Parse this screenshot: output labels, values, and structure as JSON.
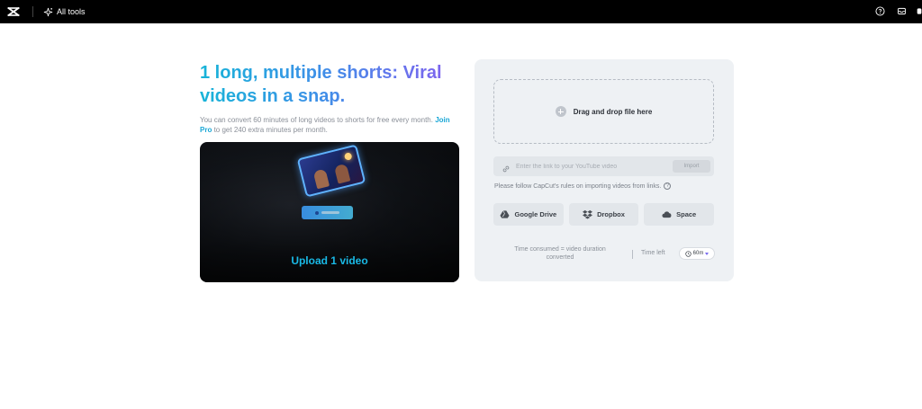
{
  "topbar": {
    "logo_icon": "capcut-logo-icon",
    "all_tools_label": "All tools",
    "right_icons": [
      "help-circle-icon",
      "inbox-icon",
      "profile-icon"
    ]
  },
  "hero": {
    "headline": "1 long, multiple shorts: Viral videos in a snap.",
    "subtext_prefix": "You can convert 60 minutes of long videos to shorts for free every month.",
    "join_pro_label": "Join Pro",
    "subtext_suffix": "to get 240 extra minutes per month.",
    "preview_caption": "Upload 1 video"
  },
  "upload_panel": {
    "drop_text": "Drag and drop file here",
    "link_placeholder": "Enter the link to your YouTube video",
    "import_label": "Import",
    "rules_text": "Please follow CapCut's rules on importing videos from links.",
    "sources": [
      {
        "label": "Google Drive",
        "icon": "google-drive-icon"
      },
      {
        "label": "Dropbox",
        "icon": "dropbox-icon"
      },
      {
        "label": "Space",
        "icon": "cloud-icon"
      }
    ],
    "time_consumed_text": "Time consumed = video duration converted",
    "time_left_label": "Time left",
    "time_left_value": "60m"
  },
  "colors": {
    "headline_gradient": [
      "#17b4d8",
      "#3f8fe8",
      "#8a5cf0"
    ],
    "link_accent": "#1aa7d6",
    "panel_bg": "#eef1f4"
  }
}
